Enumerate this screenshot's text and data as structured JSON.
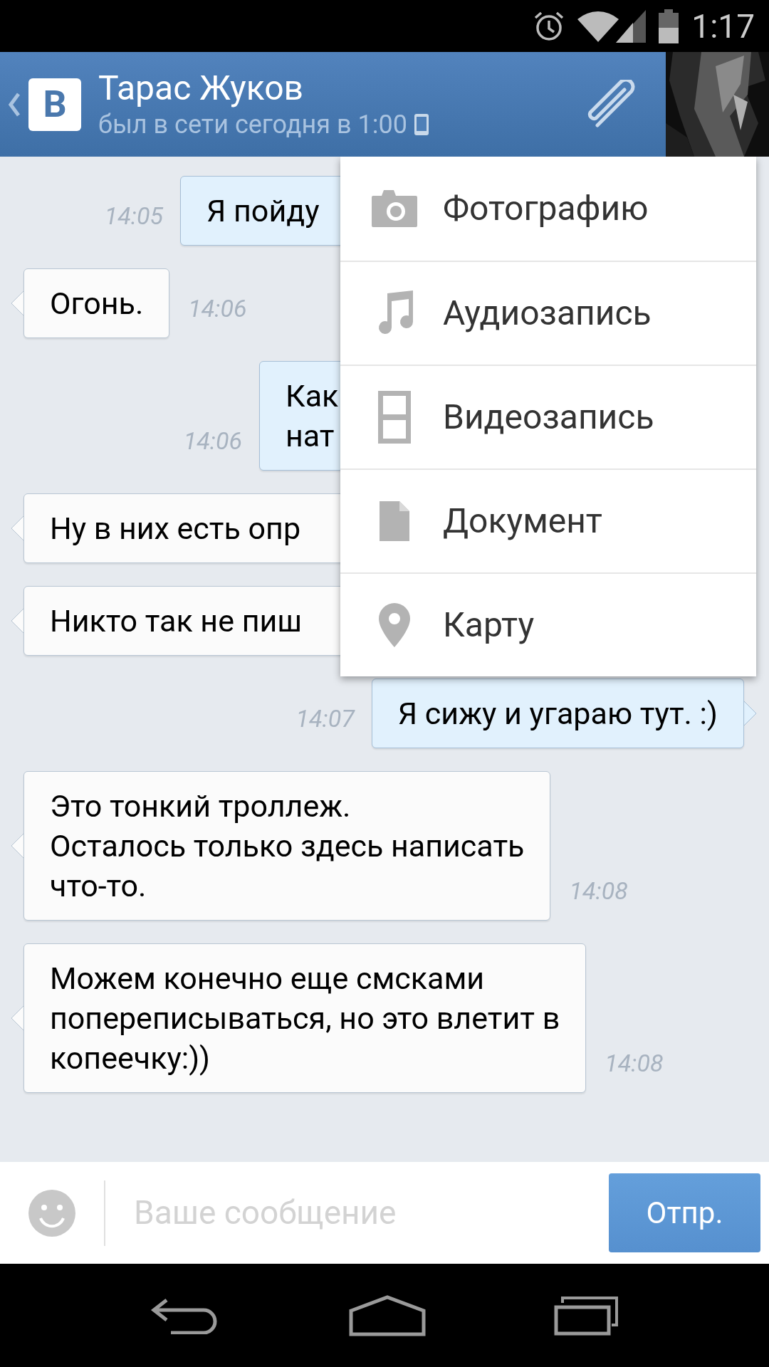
{
  "status_bar": {
    "time": "1:17"
  },
  "header": {
    "logo_letter": "В",
    "title": "Тарас Жуков",
    "subtitle": "был в сети сегодня в 1:00"
  },
  "messages": [
    {
      "kind": "outgoing",
      "lines": [
        "Я пойду"
      ],
      "time": "14:05",
      "covered": true
    },
    {
      "kind": "incoming",
      "lines": [
        "Огонь."
      ],
      "time": "14:06",
      "covered": false
    },
    {
      "kind": "outgoing",
      "lines": [
        "Как",
        "нат"
      ],
      "time": "14:06",
      "covered": true
    },
    {
      "kind": "incoming",
      "lines": [
        "Ну в них есть опр"
      ],
      "covered": true
    },
    {
      "kind": "incoming",
      "lines": [
        "Никто так не пиш"
      ],
      "covered": true
    },
    {
      "kind": "outgoing",
      "lines": [
        "Я сижу и угараю тут. :)"
      ],
      "time": "14:07",
      "covered": false
    },
    {
      "kind": "incoming",
      "lines": [
        "Это тонкий троллеж.",
        "Осталось только здесь написать",
        "что-то."
      ],
      "time": "14:08",
      "covered": false
    },
    {
      "kind": "incoming",
      "lines": [
        "Можем конечно еще смсками",
        "попереписываться, но это влетит в",
        "копеечку:))"
      ],
      "time": "14:08",
      "covered": false
    }
  ],
  "attach_menu": {
    "items": [
      {
        "label": "Фотографию"
      },
      {
        "kind": "audio",
        "label": "Аудиозапись"
      },
      {
        "kind": "video",
        "label": "Видеозапись"
      },
      {
        "kind": "document",
        "label": "Документ"
      },
      {
        "kind": "map",
        "label": "Карту"
      }
    ]
  },
  "composer": {
    "placeholder": "Ваше сообщение",
    "send": "Отпр."
  }
}
